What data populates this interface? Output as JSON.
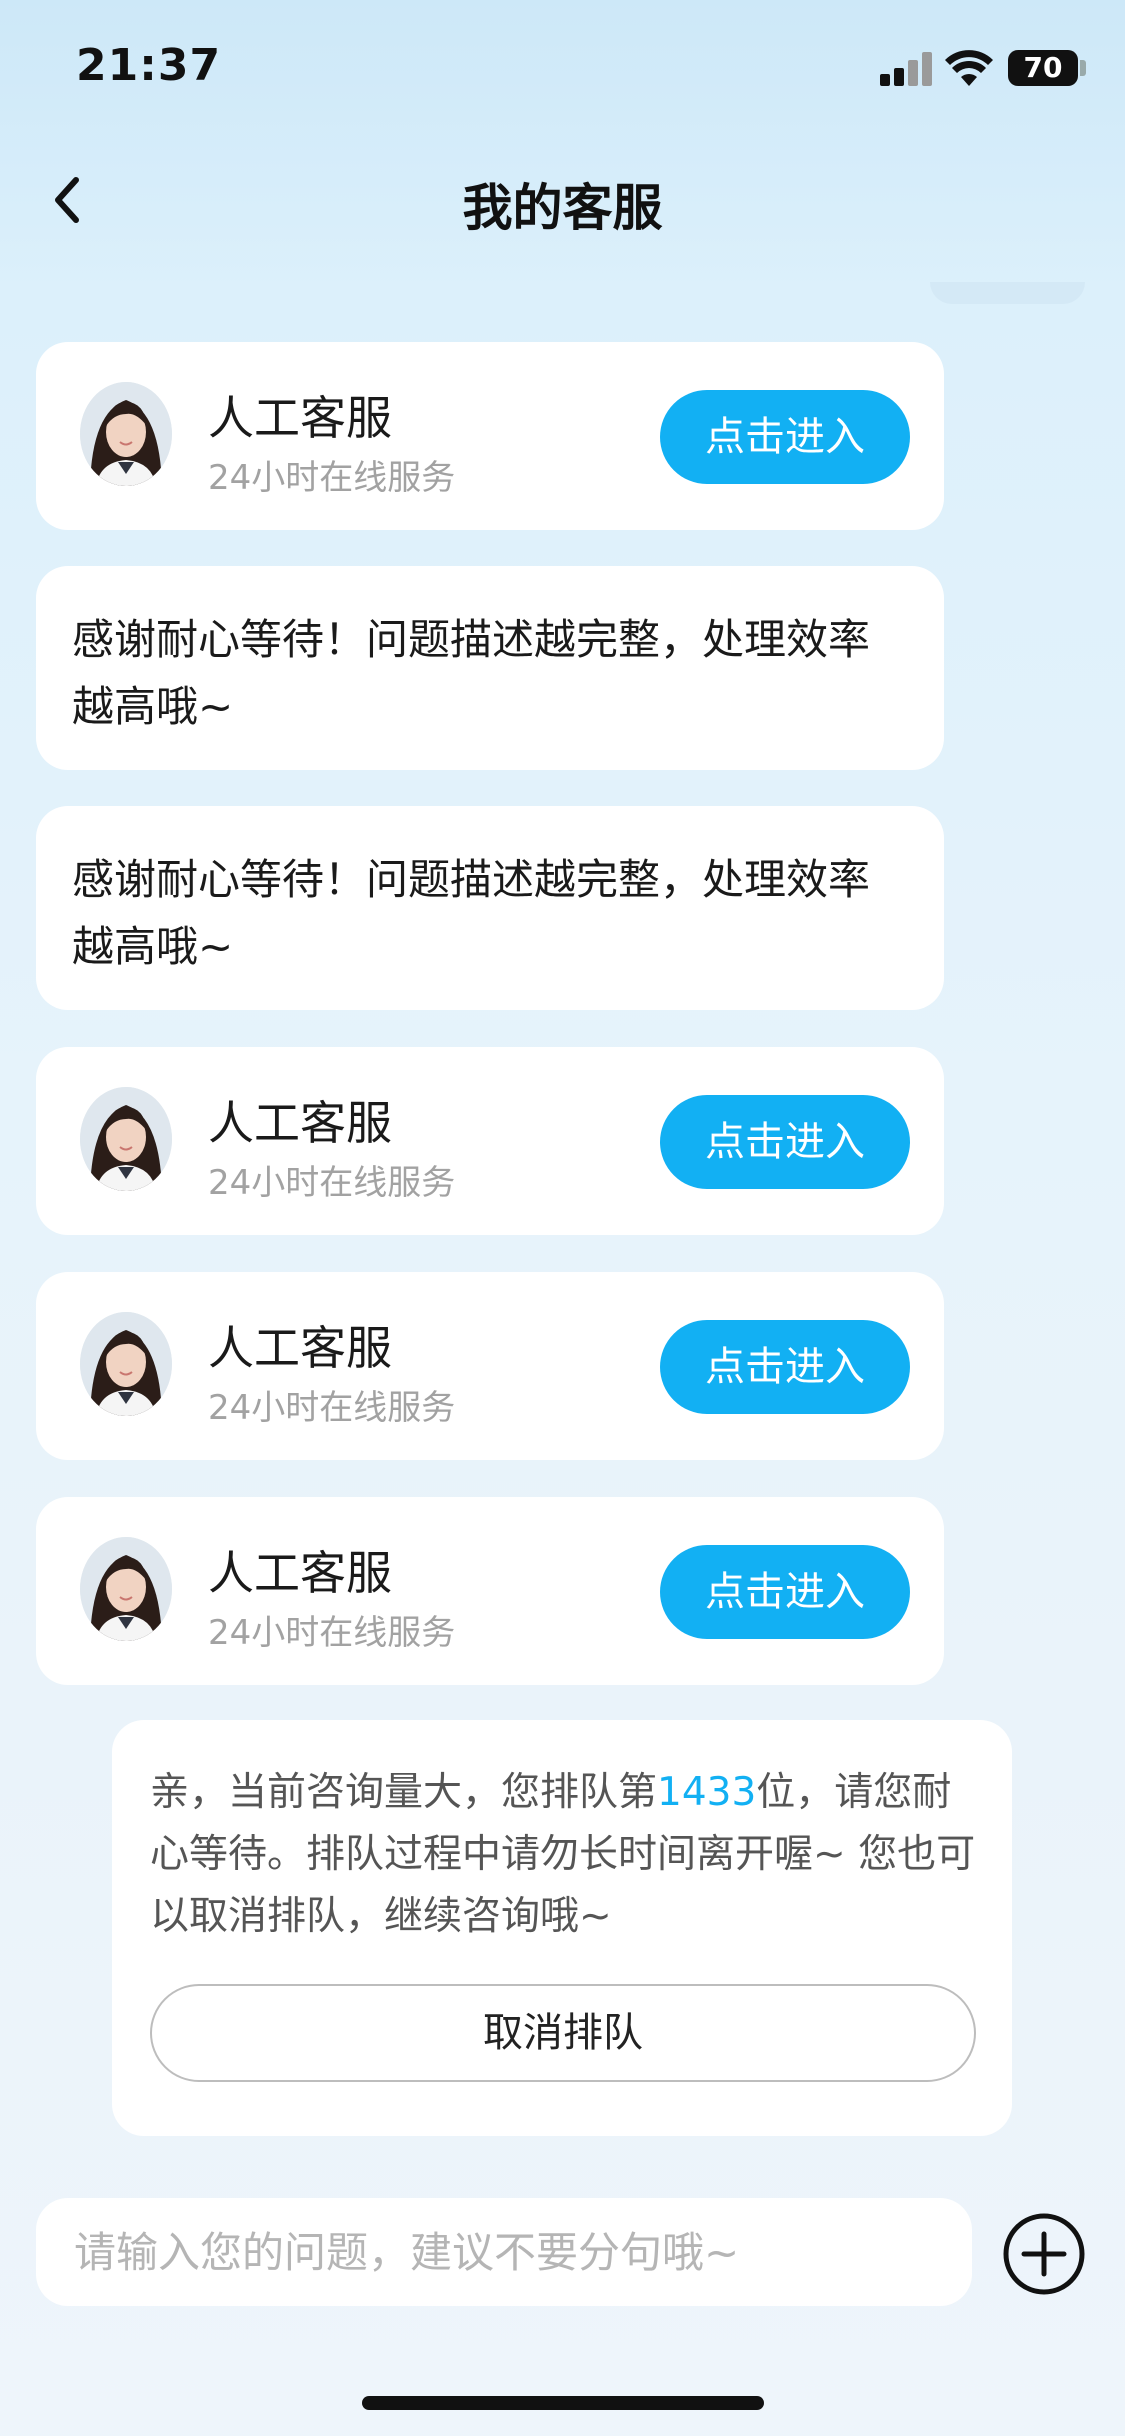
{
  "status_bar": {
    "time": "21:37",
    "battery": "70"
  },
  "nav": {
    "title": "我的客服"
  },
  "agent_cards": [
    {
      "name": "人工客服",
      "subtitle": "24小时在线服务",
      "button": "点击进入"
    },
    {
      "name": "人工客服",
      "subtitle": "24小时在线服务",
      "button": "点击进入"
    },
    {
      "name": "人工客服",
      "subtitle": "24小时在线服务",
      "button": "点击进入"
    },
    {
      "name": "人工客服",
      "subtitle": "24小时在线服务",
      "button": "点击进入"
    }
  ],
  "messages": [
    {
      "text": "感谢耐心等待！问题描述越完整，处理效率越高哦~"
    },
    {
      "text": "感谢耐心等待！问题描述越完整，处理效率越高哦~"
    }
  ],
  "queue": {
    "text_before": "亲，当前咨询量大，您排队第",
    "position": "1433",
    "text_after": "位，请您耐心等待。排队过程中请勿长时间离开喔~ 您也可以取消排队，继续咨询哦~",
    "cancel_label": "取消排队"
  },
  "input": {
    "placeholder": "请输入您的问题，建议不要分句哦~"
  },
  "icons": {
    "back": "chevron-left-icon",
    "plus": "plus-circle-icon",
    "signal": "cellular-signal-icon",
    "wifi": "wifi-icon",
    "battery": "battery-icon"
  },
  "colors": {
    "accent": "#12b0f3",
    "background": "#dcf0fb"
  }
}
